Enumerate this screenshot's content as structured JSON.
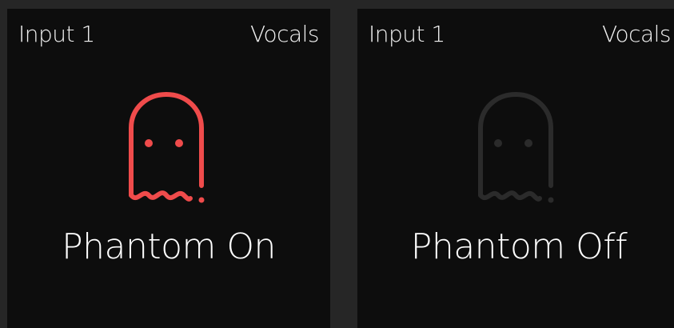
{
  "tiles": [
    {
      "input_label": "Input 1",
      "channel_label": "Vocals",
      "status_label": "Phantom On",
      "state": "on",
      "icon": "ghost-icon",
      "icon_color": "#ef4b4b"
    },
    {
      "input_label": "Input 1",
      "channel_label": "Vocals",
      "status_label": "Phantom Off",
      "state": "off",
      "icon": "ghost-icon",
      "icon_color": "#2b2b2b"
    }
  ],
  "colors": {
    "background": "#262626",
    "tile_background": "#0d0d0d",
    "text": "#f4f4f4"
  }
}
